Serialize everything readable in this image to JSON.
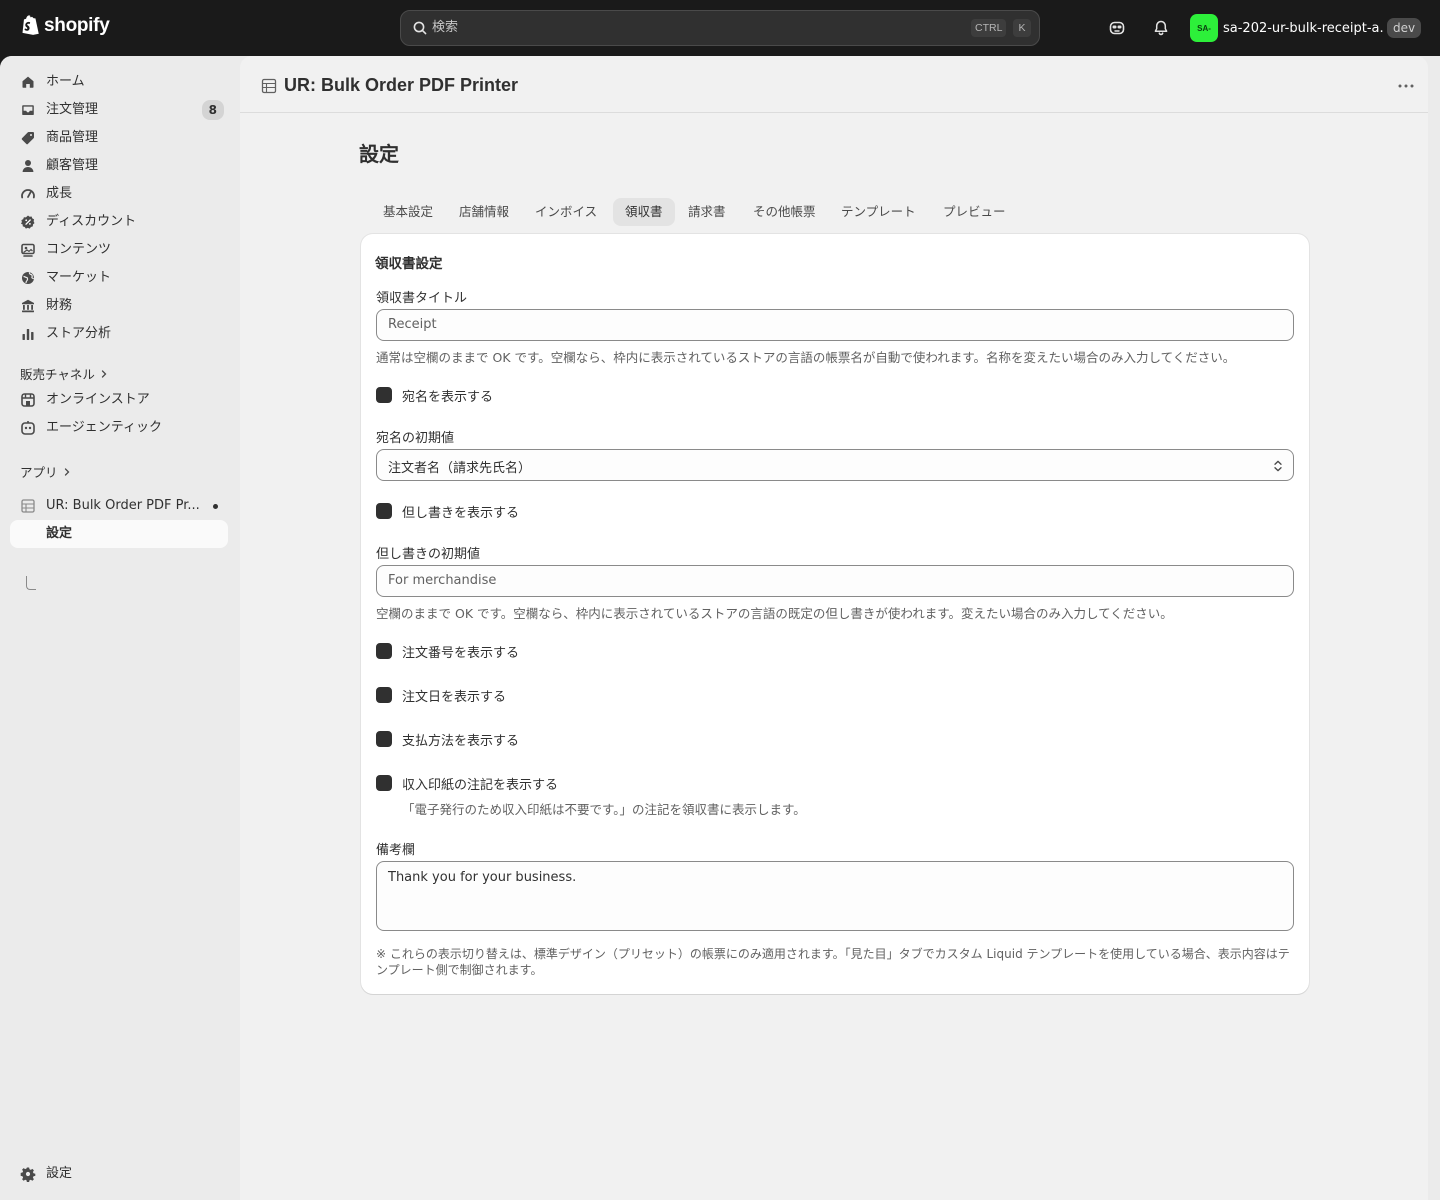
{
  "topbar": {
    "logo_text": "shopify",
    "search_placeholder": "検索",
    "shortcut_ctrl": "CTRL",
    "shortcut_key": "K",
    "store_avatar": "SA-",
    "store_name": "sa-202-ur-bulk-receipt-a...",
    "store_badge": "dev",
    "avatar_color": "#2df03a"
  },
  "sidebar": {
    "items": [
      {
        "label": "ホーム",
        "icon": "home-icon"
      },
      {
        "label": "注文管理",
        "icon": "inbox-icon",
        "badge": "8"
      },
      {
        "label": "商品管理",
        "icon": "tag-icon"
      },
      {
        "label": "顧客管理",
        "icon": "person-icon"
      },
      {
        "label": "成長",
        "icon": "gauge-icon"
      },
      {
        "label": "ディスカウント",
        "icon": "discount-icon"
      },
      {
        "label": "コンテンツ",
        "icon": "content-icon"
      },
      {
        "label": "マーケット",
        "icon": "globe-icon"
      },
      {
        "label": "財務",
        "icon": "bank-icon"
      },
      {
        "label": "ストア分析",
        "icon": "chart-icon"
      }
    ],
    "sales_channels_heading": "販売チャネル",
    "channels": [
      {
        "label": "オンラインストア",
        "icon": "store-icon"
      },
      {
        "label": "エージェンティック",
        "icon": "agent-icon"
      }
    ],
    "apps_heading": "アプリ",
    "app_item": "UR: Bulk Order PDF Pr...",
    "app_sub_item": "設定",
    "settings_label": "設定"
  },
  "main": {
    "app_title": "UR: Bulk Order PDF Printer",
    "page_title": "設定",
    "tabs": [
      {
        "label": "基本設定",
        "active": false
      },
      {
        "label": "店舗情報",
        "active": false
      },
      {
        "label": "インボイス",
        "active": false
      },
      {
        "label": "領収書",
        "active": true
      },
      {
        "label": "請求書",
        "active": false
      },
      {
        "label": "その他帳票",
        "active": false
      },
      {
        "label": "テンプレート",
        "active": false
      },
      {
        "label": "プレビュー",
        "active": false
      }
    ]
  },
  "receipt": {
    "section_title": "領収書設定",
    "title_label": "領収書タイトル",
    "title_placeholder": "Receipt",
    "title_help": "通常は空欄のままで OK です。空欄なら、枠内に表示されているストアの言語の帳票名が自動で使われます。名称を変えたい場合のみ入力してください。",
    "show_addressee": "宛名を表示する",
    "addressee_default_label": "宛名の初期値",
    "addressee_default_value": "注文者名（請求先氏名）",
    "show_proviso": "但し書きを表示する",
    "proviso_default_label": "但し書きの初期値",
    "proviso_placeholder": "For merchandise",
    "proviso_help": "空欄のままで OK です。空欄なら、枠内に表示されているストアの言語の既定の但し書きが使われます。変えたい場合のみ入力してください。",
    "show_order_number": "注文番号を表示する",
    "show_order_date": "注文日を表示する",
    "show_payment_method": "支払方法を表示する",
    "show_stamp_note": "収入印紙の注記を表示する",
    "stamp_note_help": "「電子発行のため収入印紙は不要です。」の注記を領収書に表示します。",
    "remarks_label": "備考欄",
    "remarks_value": "Thank you for your business.",
    "footer_note": "※ これらの表示切り替えは、標準デザイン（プリセット）の帳票にのみ適用されます。「見た目」タブでカスタム Liquid テンプレートを使用している場合、表示内容はテンプレート側で制御されます。"
  }
}
